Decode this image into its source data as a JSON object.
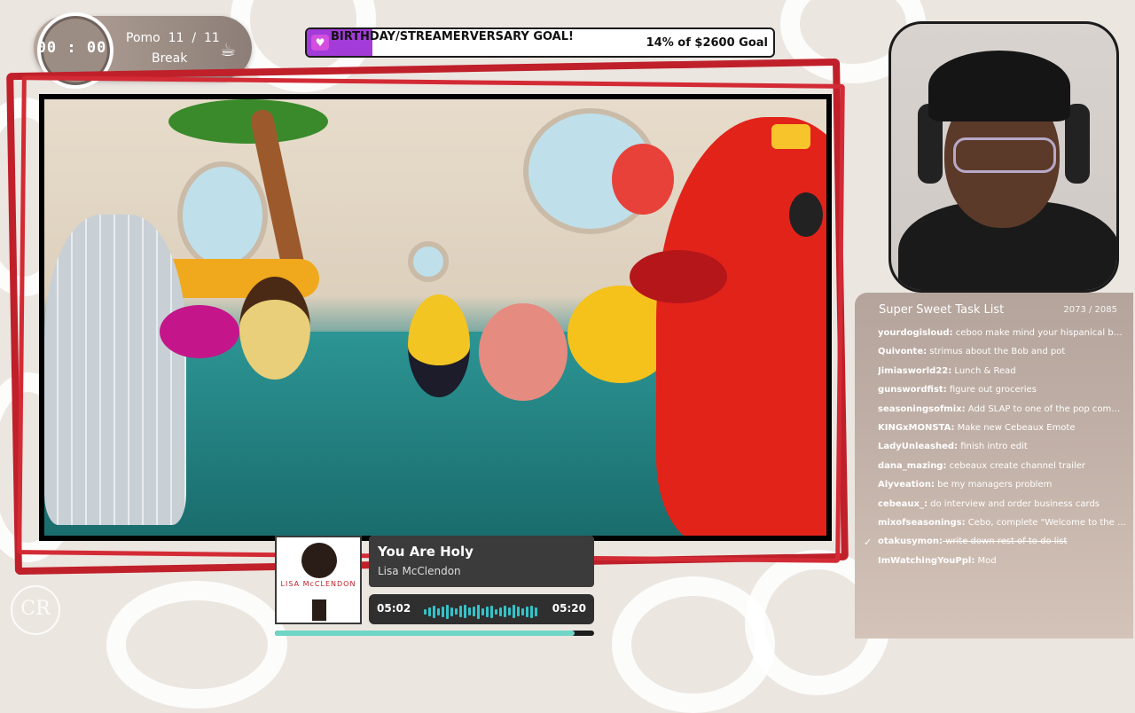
{
  "pomodoro": {
    "time": "00 : 00",
    "counter": "Pomo  11  /  11",
    "mode": "Break",
    "icon": "coffee-cup-icon"
  },
  "goal": {
    "title": "BIRTHDAY/STREAMERVERSARY GOAL!",
    "progress_text": "14% of $2600 Goal",
    "progress": 0.14,
    "accent": "#a23bd8"
  },
  "task_list": {
    "title": "Super Sweet Task List",
    "count": "2073 / 2085",
    "tasks": [
      {
        "user": "yourdogisloud:",
        "text": "ceboo make mind your hispanical busin...",
        "done": false
      },
      {
        "user": "Quivonte:",
        "text": "strimus about the Bob and pot",
        "done": false
      },
      {
        "user": "Jimiasworld22:",
        "text": "Lunch & Read",
        "done": false
      },
      {
        "user": "gunswordfist:",
        "text": "figure out groceries",
        "done": false
      },
      {
        "user": "seasoningsofmix:",
        "text": "Add SLAP to one of the pop commands.",
        "done": false
      },
      {
        "user": "KINGxMONSTA:",
        "text": "Make new Cebeaux Emote",
        "done": false
      },
      {
        "user": "LadyUnleashed:",
        "text": "finish intro edit",
        "done": false
      },
      {
        "user": "dana_mazing:",
        "text": "cebeaux create channel trailer",
        "done": false
      },
      {
        "user": "Alyveation:",
        "text": "be my managers problem",
        "done": false
      },
      {
        "user": "cebeaux_:",
        "text": "do interview and order business cards",
        "done": false
      },
      {
        "user": "mixofseasonings:",
        "text": "Cebo, complete \"Welcome to the GB!\"",
        "done": false
      },
      {
        "user": "otakusymon:",
        "text": "write down rest of to do list",
        "done": true
      },
      {
        "user": "ImWatchingYouPpl:",
        "text": "Mod",
        "done": false
      }
    ]
  },
  "music": {
    "song": "You Are Holy",
    "artist": "Lisa McClendon",
    "album_text": "LISA McCLENDON",
    "current_time": "05:02",
    "total_time": "05:20",
    "progress": 0.94
  },
  "logo_text": "CR"
}
